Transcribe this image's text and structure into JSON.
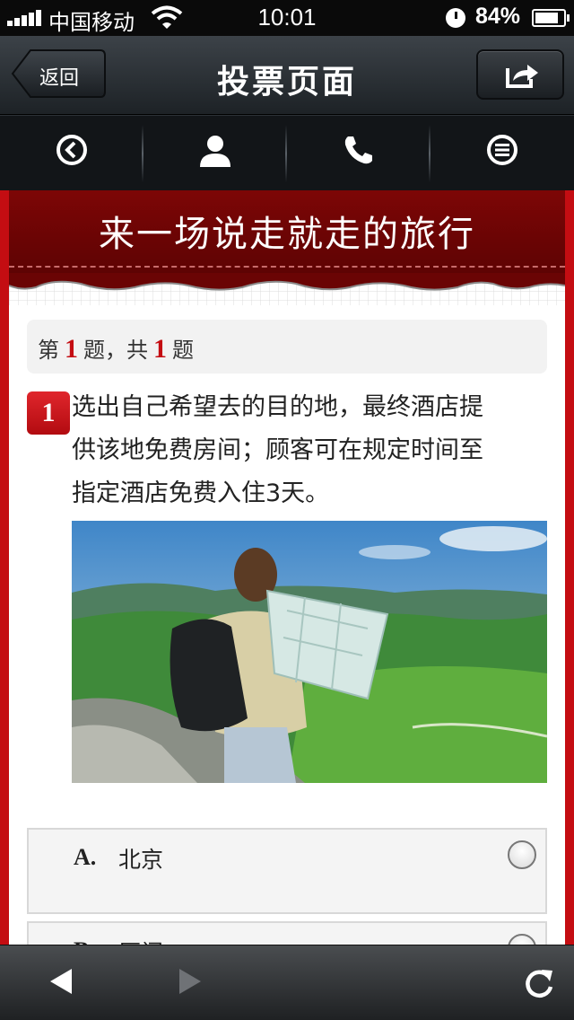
{
  "status_bar": {
    "carrier": "中国移动",
    "time": "10:01",
    "battery_percent_text": "84%",
    "battery_level": 0.84
  },
  "nav": {
    "back_label": "返回",
    "title": "投票页面"
  },
  "toolbar": {
    "items": [
      "back-circle-icon",
      "user-icon",
      "phone-icon",
      "menu-icon"
    ]
  },
  "banner": {
    "title": "来一场说走就走的旅行"
  },
  "question": {
    "counter_prefix": "第",
    "current": "1",
    "counter_mid": "题，共",
    "total": "1",
    "counter_suffix": "题",
    "number": "1",
    "text_line1": "选出自己希望去的目的地，最终酒店提",
    "text_line2": "供该地免费房间；顾客可在规定时间至",
    "text_line3": "指定酒店免费入住3天。"
  },
  "options": [
    {
      "letter": "A.",
      "label": "北京"
    },
    {
      "letter": "B.",
      "label": "厦门"
    }
  ],
  "colors": {
    "accent_red": "#c40d12",
    "banner_dark_red": "#6a0404",
    "nav_dark": "#1d2226"
  }
}
